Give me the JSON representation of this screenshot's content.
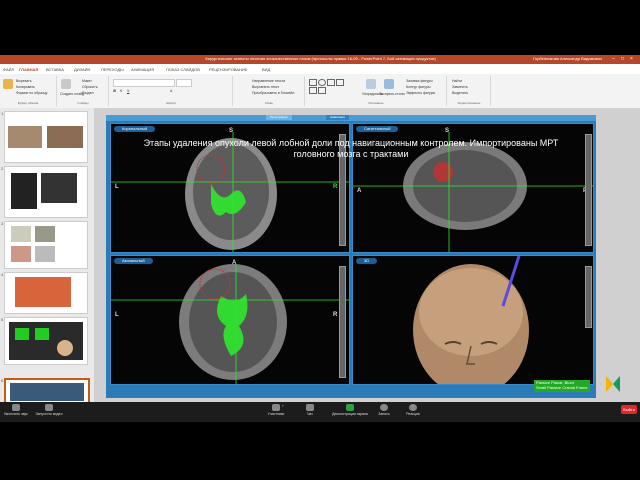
{
  "ppt": {
    "title": "Хирургические аспекты лечения злокачественных глиом (протоколы правки 16-09 - PowerPoint 7, Бой активация продуктов)",
    "user": "Горбенникова Александр Вадимович",
    "tabs": [
      "ФАЙЛ",
      "ГЛАВНАЯ",
      "ВСТАВКА",
      "ДИЗАЙН",
      "ПЕРЕХОДЫ",
      "АНИМАЦИЯ",
      "ПОКАЗ СЛАЙДОВ",
      "РЕЦЕНЗИРОВАНИЕ",
      "ВИД"
    ],
    "ribbon": {
      "groups": [
        "Буфер обмена",
        "Слайды",
        "Шрифт",
        "Абзац",
        "Рисование",
        "Редактирование"
      ],
      "clipboard_items": [
        "Вырезать",
        "Копировать",
        "Формат по образцу"
      ],
      "slides_items": [
        "Создать слайд",
        "Макет",
        "Сбросить",
        "Раздел"
      ],
      "paragraph_items": [
        "Направление текста",
        "Выровнять текст",
        "Преобразовать в SmartArt"
      ],
      "drawing_items": [
        "Упорядочить",
        "Экспресс-стили",
        "Заливка фигуры",
        "Контур фигуры",
        "Эффекты фигуры"
      ],
      "editing_items": [
        "Найти",
        "Заменить",
        "Выделить"
      ]
    },
    "slide_numbers": [
      "1",
      "2",
      "3",
      "4",
      "5",
      "6",
      "7"
    ]
  },
  "slide": {
    "caption_line1": "Этапы удаления опухоли левой лобной доли под навигационным контролем. Импортированы МРТ",
    "caption_line2": "головного мозга с трактами",
    "nav_tabs": [
      "Регистрация",
      "Навигация"
    ],
    "panels": {
      "coronal": "Корональный",
      "sagittal": "Сагиттальный",
      "axial": "Аксиальный",
      "threed": "3D"
    },
    "orient": {
      "s": "S",
      "l": "L",
      "r": "R",
      "a": "A",
      "p": "P"
    },
    "info_line1": "Passive Planar, Blunt",
    "info_line2": "Small Passive Cranial Frame"
  },
  "zoom": {
    "buttons": [
      "Включить звук",
      "Запустить видео",
      "Участники",
      "Чат",
      "Демонстрация экрана",
      "Запись",
      "Реакции"
    ],
    "participants_count": "7",
    "leave": "Выйти"
  },
  "colors": {
    "accent": "#b7472a",
    "slide_bg": "#2a7bb8",
    "tract": "#2ee82e",
    "leave": "#e02828"
  }
}
